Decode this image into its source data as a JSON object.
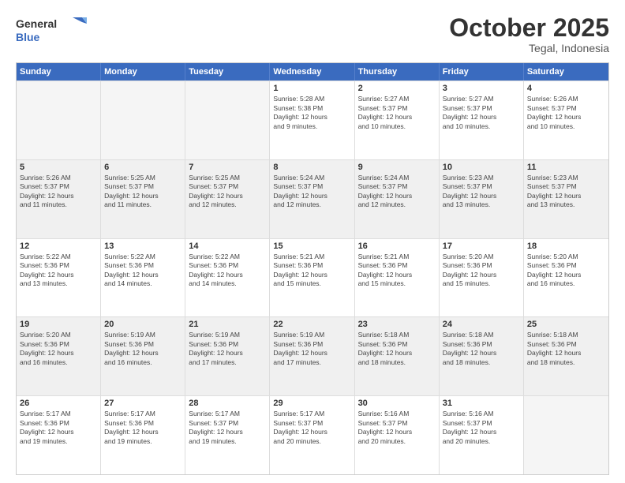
{
  "header": {
    "logo_general": "General",
    "logo_blue": "Blue",
    "month_title": "October 2025",
    "location": "Tegal, Indonesia"
  },
  "days_of_week": [
    "Sunday",
    "Monday",
    "Tuesday",
    "Wednesday",
    "Thursday",
    "Friday",
    "Saturday"
  ],
  "weeks": [
    [
      {
        "day": "",
        "empty": true
      },
      {
        "day": "",
        "empty": true
      },
      {
        "day": "",
        "empty": true
      },
      {
        "day": "1",
        "lines": [
          "Sunrise: 5:28 AM",
          "Sunset: 5:38 PM",
          "Daylight: 12 hours",
          "and 9 minutes."
        ]
      },
      {
        "day": "2",
        "lines": [
          "Sunrise: 5:27 AM",
          "Sunset: 5:37 PM",
          "Daylight: 12 hours",
          "and 10 minutes."
        ]
      },
      {
        "day": "3",
        "lines": [
          "Sunrise: 5:27 AM",
          "Sunset: 5:37 PM",
          "Daylight: 12 hours",
          "and 10 minutes."
        ]
      },
      {
        "day": "4",
        "lines": [
          "Sunrise: 5:26 AM",
          "Sunset: 5:37 PM",
          "Daylight: 12 hours",
          "and 10 minutes."
        ]
      }
    ],
    [
      {
        "day": "5",
        "lines": [
          "Sunrise: 5:26 AM",
          "Sunset: 5:37 PM",
          "Daylight: 12 hours",
          "and 11 minutes."
        ]
      },
      {
        "day": "6",
        "lines": [
          "Sunrise: 5:25 AM",
          "Sunset: 5:37 PM",
          "Daylight: 12 hours",
          "and 11 minutes."
        ]
      },
      {
        "day": "7",
        "lines": [
          "Sunrise: 5:25 AM",
          "Sunset: 5:37 PM",
          "Daylight: 12 hours",
          "and 12 minutes."
        ]
      },
      {
        "day": "8",
        "lines": [
          "Sunrise: 5:24 AM",
          "Sunset: 5:37 PM",
          "Daylight: 12 hours",
          "and 12 minutes."
        ]
      },
      {
        "day": "9",
        "lines": [
          "Sunrise: 5:24 AM",
          "Sunset: 5:37 PM",
          "Daylight: 12 hours",
          "and 12 minutes."
        ]
      },
      {
        "day": "10",
        "lines": [
          "Sunrise: 5:23 AM",
          "Sunset: 5:37 PM",
          "Daylight: 12 hours",
          "and 13 minutes."
        ]
      },
      {
        "day": "11",
        "lines": [
          "Sunrise: 5:23 AM",
          "Sunset: 5:37 PM",
          "Daylight: 12 hours",
          "and 13 minutes."
        ]
      }
    ],
    [
      {
        "day": "12",
        "lines": [
          "Sunrise: 5:22 AM",
          "Sunset: 5:36 PM",
          "Daylight: 12 hours",
          "and 13 minutes."
        ]
      },
      {
        "day": "13",
        "lines": [
          "Sunrise: 5:22 AM",
          "Sunset: 5:36 PM",
          "Daylight: 12 hours",
          "and 14 minutes."
        ]
      },
      {
        "day": "14",
        "lines": [
          "Sunrise: 5:22 AM",
          "Sunset: 5:36 PM",
          "Daylight: 12 hours",
          "and 14 minutes."
        ]
      },
      {
        "day": "15",
        "lines": [
          "Sunrise: 5:21 AM",
          "Sunset: 5:36 PM",
          "Daylight: 12 hours",
          "and 15 minutes."
        ]
      },
      {
        "day": "16",
        "lines": [
          "Sunrise: 5:21 AM",
          "Sunset: 5:36 PM",
          "Daylight: 12 hours",
          "and 15 minutes."
        ]
      },
      {
        "day": "17",
        "lines": [
          "Sunrise: 5:20 AM",
          "Sunset: 5:36 PM",
          "Daylight: 12 hours",
          "and 15 minutes."
        ]
      },
      {
        "day": "18",
        "lines": [
          "Sunrise: 5:20 AM",
          "Sunset: 5:36 PM",
          "Daylight: 12 hours",
          "and 16 minutes."
        ]
      }
    ],
    [
      {
        "day": "19",
        "lines": [
          "Sunrise: 5:20 AM",
          "Sunset: 5:36 PM",
          "Daylight: 12 hours",
          "and 16 minutes."
        ]
      },
      {
        "day": "20",
        "lines": [
          "Sunrise: 5:19 AM",
          "Sunset: 5:36 PM",
          "Daylight: 12 hours",
          "and 16 minutes."
        ]
      },
      {
        "day": "21",
        "lines": [
          "Sunrise: 5:19 AM",
          "Sunset: 5:36 PM",
          "Daylight: 12 hours",
          "and 17 minutes."
        ]
      },
      {
        "day": "22",
        "lines": [
          "Sunrise: 5:19 AM",
          "Sunset: 5:36 PM",
          "Daylight: 12 hours",
          "and 17 minutes."
        ]
      },
      {
        "day": "23",
        "lines": [
          "Sunrise: 5:18 AM",
          "Sunset: 5:36 PM",
          "Daylight: 12 hours",
          "and 18 minutes."
        ]
      },
      {
        "day": "24",
        "lines": [
          "Sunrise: 5:18 AM",
          "Sunset: 5:36 PM",
          "Daylight: 12 hours",
          "and 18 minutes."
        ]
      },
      {
        "day": "25",
        "lines": [
          "Sunrise: 5:18 AM",
          "Sunset: 5:36 PM",
          "Daylight: 12 hours",
          "and 18 minutes."
        ]
      }
    ],
    [
      {
        "day": "26",
        "lines": [
          "Sunrise: 5:17 AM",
          "Sunset: 5:36 PM",
          "Daylight: 12 hours",
          "and 19 minutes."
        ]
      },
      {
        "day": "27",
        "lines": [
          "Sunrise: 5:17 AM",
          "Sunset: 5:36 PM",
          "Daylight: 12 hours",
          "and 19 minutes."
        ]
      },
      {
        "day": "28",
        "lines": [
          "Sunrise: 5:17 AM",
          "Sunset: 5:37 PM",
          "Daylight: 12 hours",
          "and 19 minutes."
        ]
      },
      {
        "day": "29",
        "lines": [
          "Sunrise: 5:17 AM",
          "Sunset: 5:37 PM",
          "Daylight: 12 hours",
          "and 20 minutes."
        ]
      },
      {
        "day": "30",
        "lines": [
          "Sunrise: 5:16 AM",
          "Sunset: 5:37 PM",
          "Daylight: 12 hours",
          "and 20 minutes."
        ]
      },
      {
        "day": "31",
        "lines": [
          "Sunrise: 5:16 AM",
          "Sunset: 5:37 PM",
          "Daylight: 12 hours",
          "and 20 minutes."
        ]
      },
      {
        "day": "",
        "empty": true
      }
    ]
  ]
}
